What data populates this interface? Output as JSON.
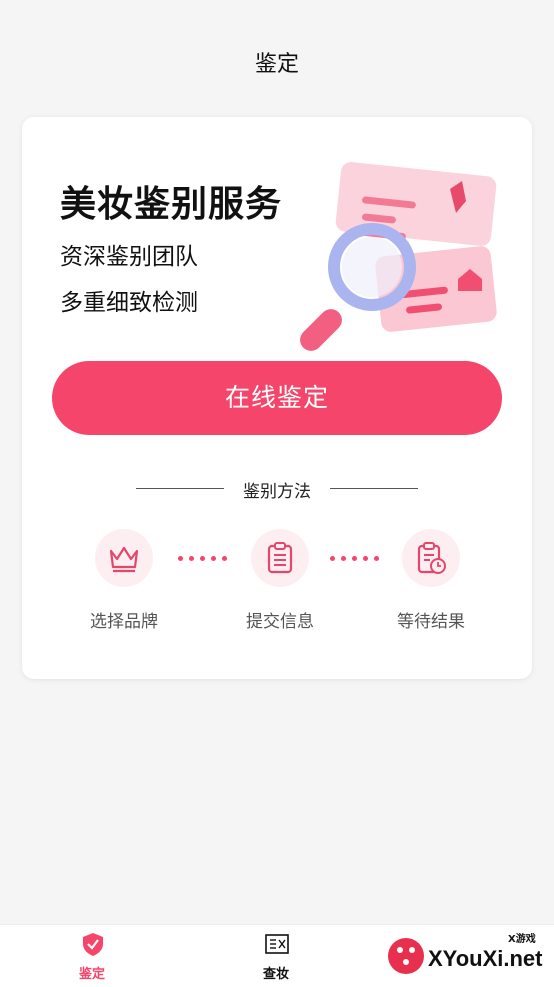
{
  "header": {
    "title": "鉴定"
  },
  "hero": {
    "title": "美妆鉴别服务",
    "subtitle_1": "资深鉴别团队",
    "subtitle_2": "多重细致检测"
  },
  "cta": {
    "label": "在线鉴定"
  },
  "method": {
    "title": "鉴别方法",
    "steps": [
      {
        "label": "选择品牌",
        "icon": "crown-icon"
      },
      {
        "label": "提交信息",
        "icon": "clipboard-list-icon"
      },
      {
        "label": "等待结果",
        "icon": "clipboard-clock-icon"
      }
    ]
  },
  "tabbar": {
    "items": [
      {
        "label": "鉴定",
        "icon": "shield-check-icon",
        "active": true
      },
      {
        "label": "查妆",
        "icon": "search-makeup-icon",
        "active": false
      }
    ]
  },
  "watermark": {
    "text": "XYouXi.net",
    "badge": "X游戏"
  },
  "colors": {
    "accent": "#f5456a",
    "accent_light": "#fdeef1",
    "background": "#f5f5f5"
  }
}
